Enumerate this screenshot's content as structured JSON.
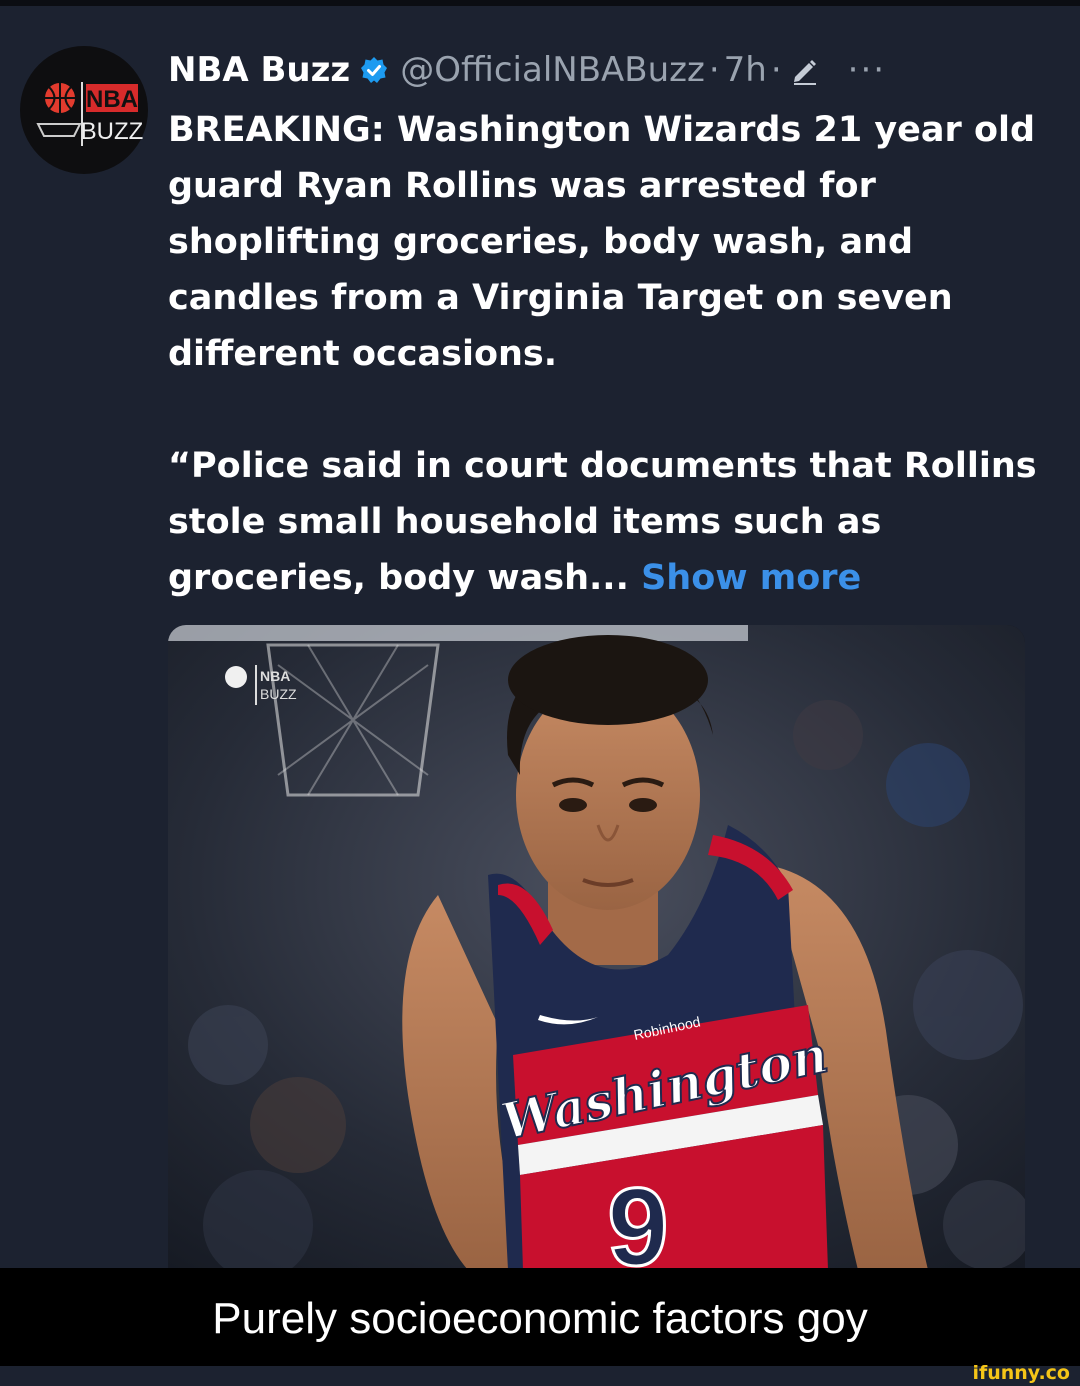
{
  "tweet": {
    "author_name": "NBA Buzz",
    "handle": "@OfficialNBABuzz",
    "time": "7h",
    "more_icon": "ellipsis-icon",
    "avatar_logo_text": [
      "NBA",
      "BUZZ"
    ],
    "paragraph_1": "BREAKING: Washington Wizards 21 year old guard Ryan Rollins was arrested for shoplifting groceries, body wash, and candles from a Virginia Target on seven different occasions.",
    "paragraph_2": "“Police said in court documents that Rollins stole small household items such as groceries, body wash...",
    "show_more": "Show more",
    "media": {
      "logo_text": [
        "NBA",
        "BUZZ"
      ],
      "jersey_text": "Washington",
      "jersey_sponsor": "Robinhood",
      "jersey_number": "9"
    }
  },
  "meme": {
    "caption": "Purely socioeconomic factors goy"
  },
  "watermark": "ifunny.co",
  "colors": {
    "background": "#1c2230",
    "link": "#3b90e8",
    "verified": "#1d9bf0",
    "meta": "#9aa3af",
    "caption_bar": "#000000",
    "watermark": "#f5c518"
  }
}
